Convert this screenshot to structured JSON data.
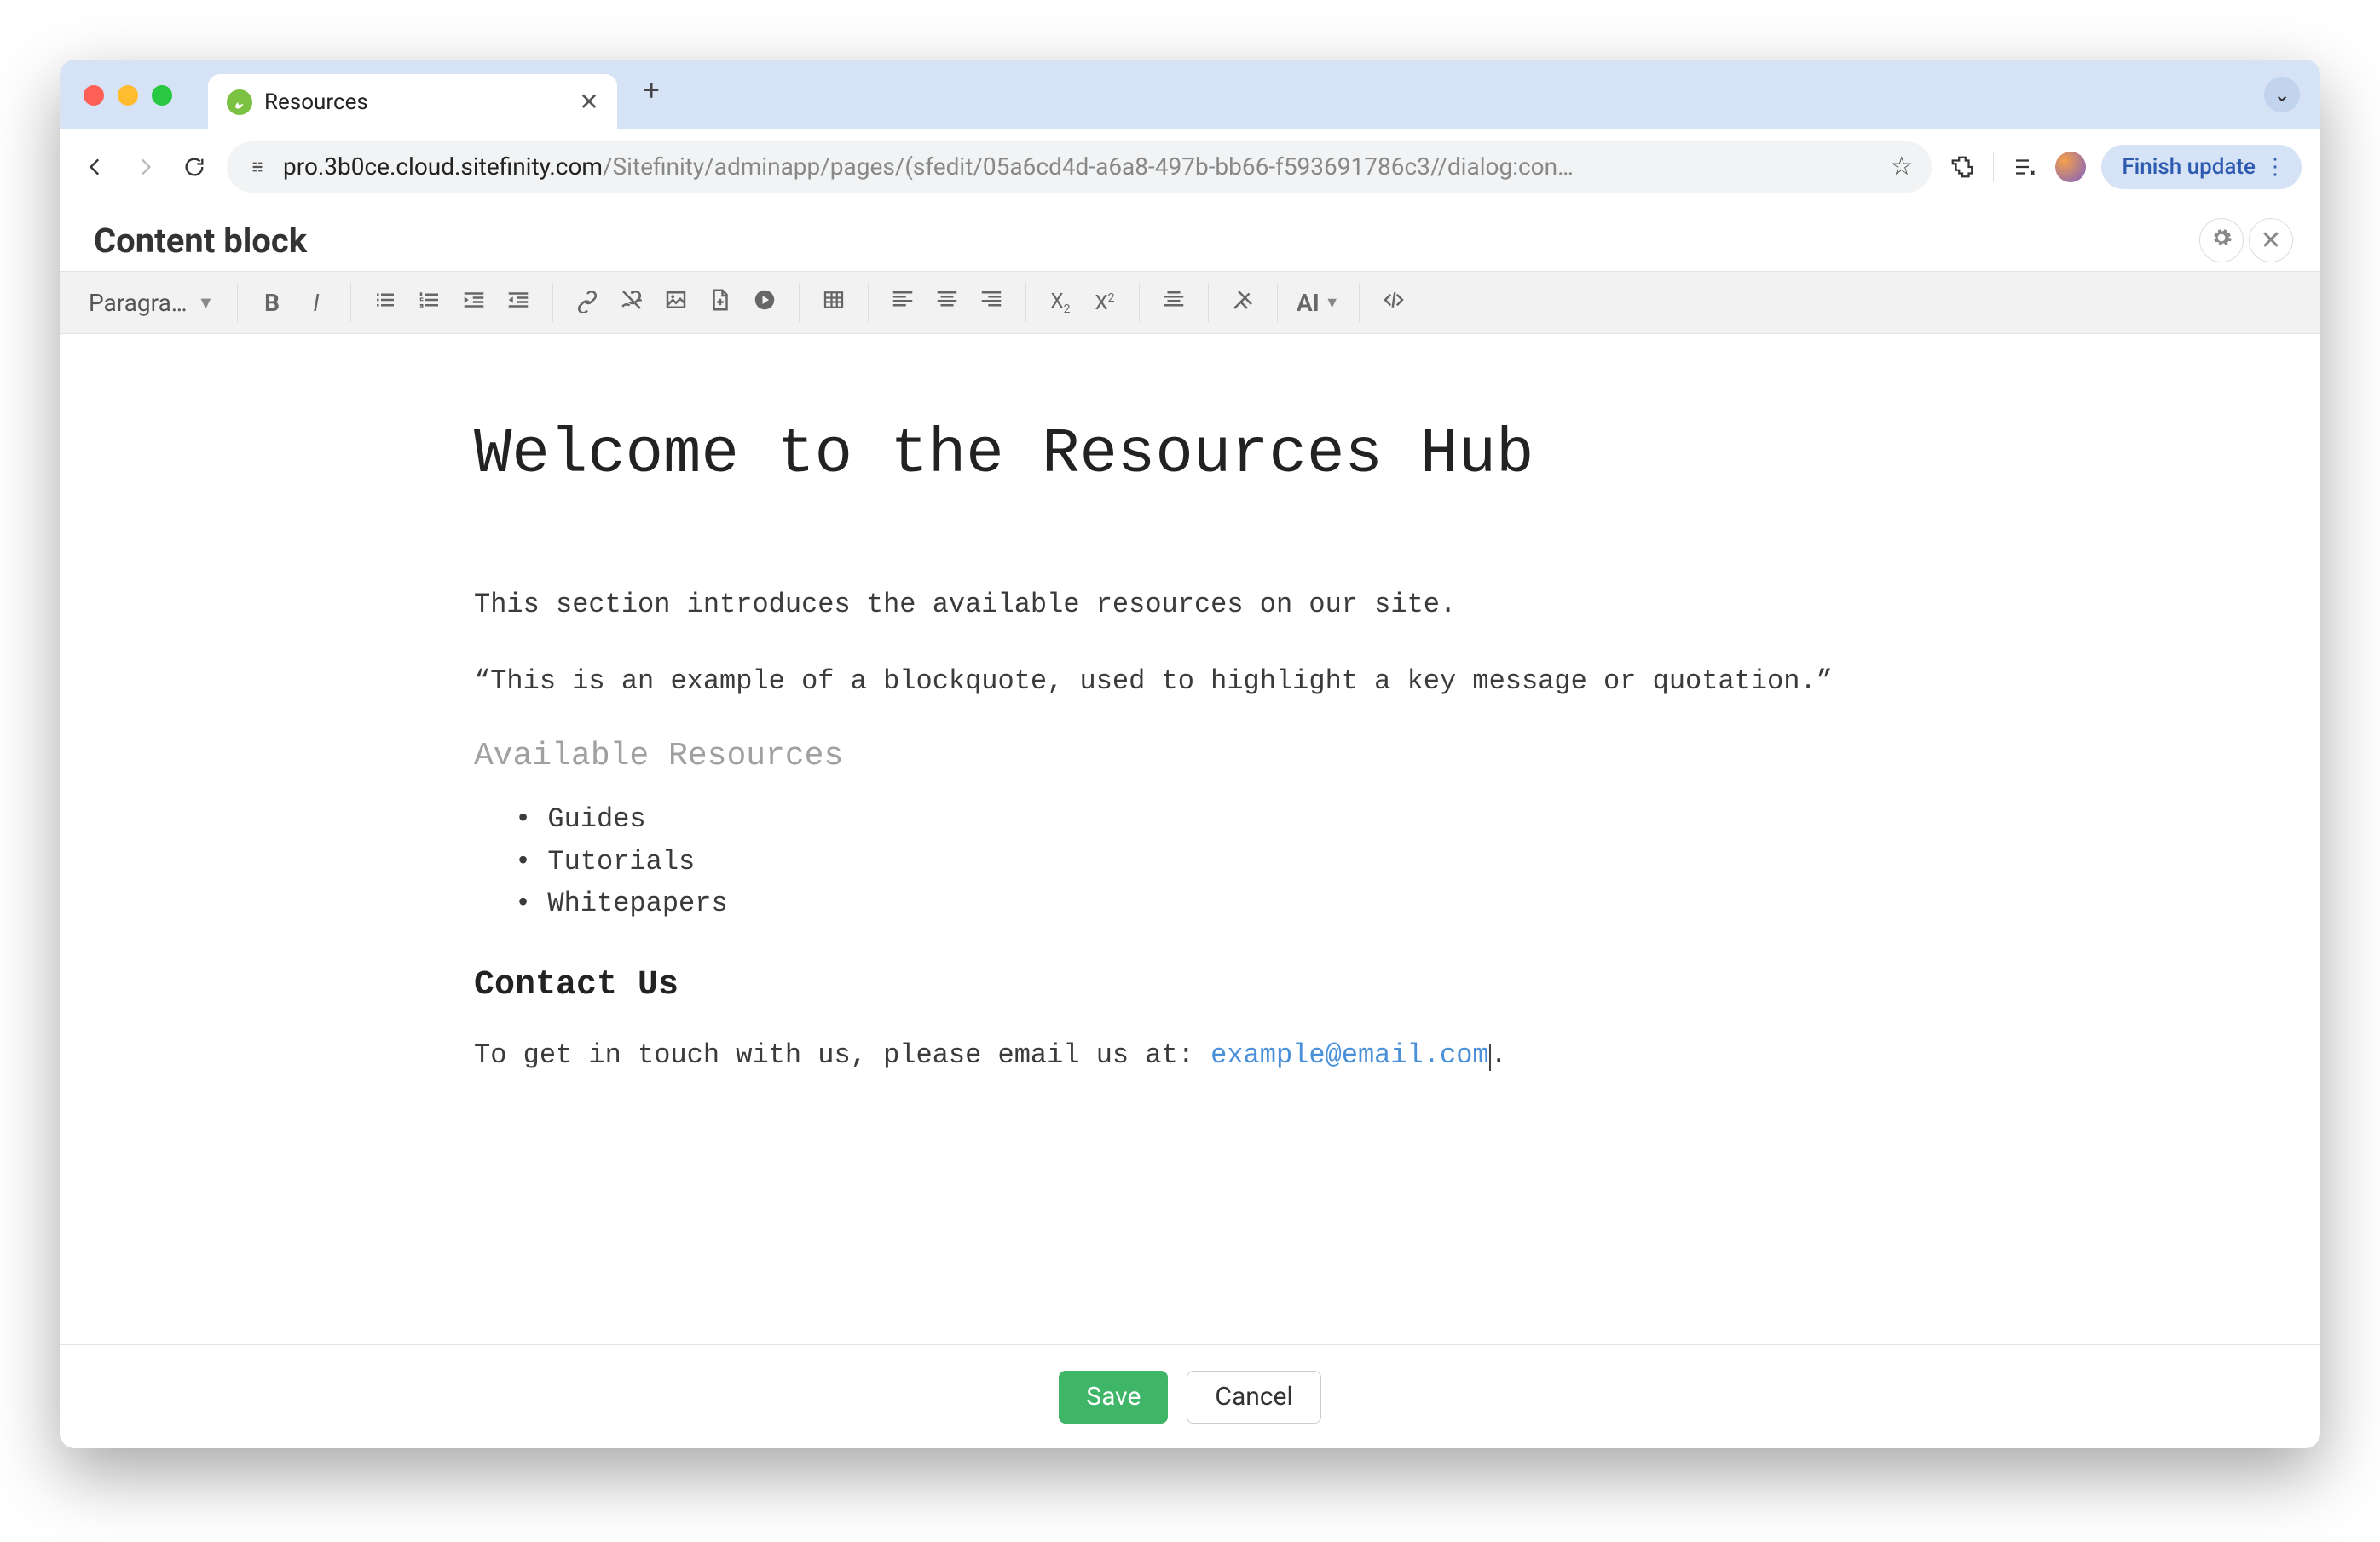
{
  "browser": {
    "tab_title": "Resources",
    "url_dark": "pro.3b0ce.cloud.sitefinity.com",
    "url_rest": "/Sitefinity/adminapp/pages/(sfedit/05a6cd4d-a6a8-497b-bb66-f593691786c3//dialog:con…",
    "finish_update": "Finish update"
  },
  "dialog": {
    "title": "Content block"
  },
  "toolbar": {
    "format_dd": "Paragra…",
    "ai_label": "AI"
  },
  "content": {
    "h1": "Welcome to the Resources Hub",
    "intro": "This section introduces the available resources on our site.",
    "blockquote": "“This is an example of a blockquote, used to highlight a key message or quotation.”",
    "h3": "Available Resources",
    "list": [
      "Guides",
      "Tutorials",
      "Whitepapers"
    ],
    "h2": "Contact Us",
    "contact_pre": "To get in touch with us, please email us at: ",
    "contact_link": "example@email.com",
    "contact_post": "."
  },
  "footer": {
    "save": "Save",
    "cancel": "Cancel"
  }
}
